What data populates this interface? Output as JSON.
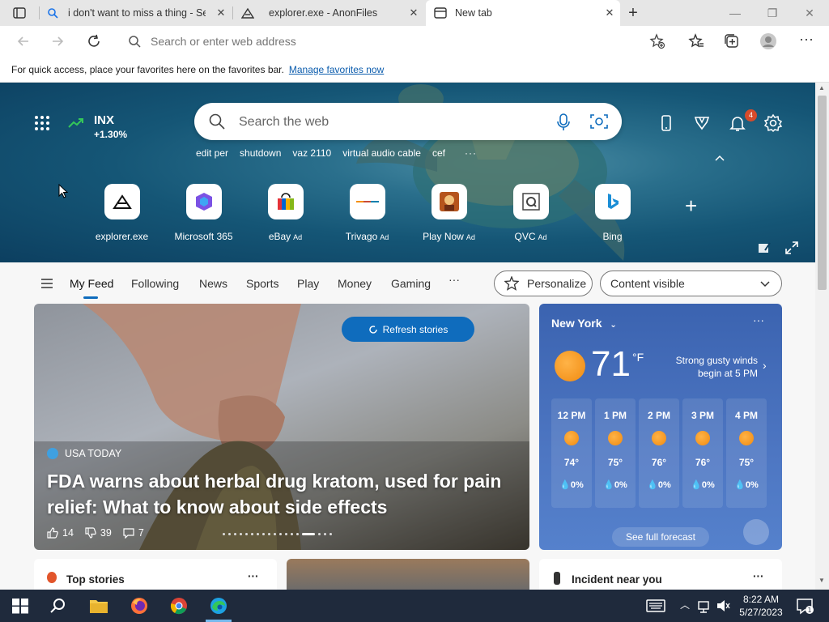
{
  "tabs": [
    {
      "label": "i don't want to miss a thing - Search",
      "icon": "search-icon"
    },
    {
      "label": "explorer.exe - AnonFiles",
      "icon": "anonfiles-icon"
    },
    {
      "label": "New tab",
      "icon": "newtab-icon"
    }
  ],
  "toolbar": {
    "address_placeholder": "Search or enter web address"
  },
  "favbar": {
    "message": "For quick access, place your favorites here on the favorites bar.",
    "link": "Manage favorites now"
  },
  "hero": {
    "ticker_symbol": "INX",
    "ticker_change": "+1.30%",
    "search_placeholder": "Search the web",
    "trending": [
      "edit per",
      "shutdown",
      "vaz 2110",
      "virtual audio cable",
      "cef"
    ],
    "notification_count": "4",
    "quick_links": [
      {
        "name": "explorer.exe",
        "ad": ""
      },
      {
        "name": "Microsoft 365",
        "ad": ""
      },
      {
        "name": "eBay",
        "ad": "Ad"
      },
      {
        "name": "Trivago",
        "ad": "Ad"
      },
      {
        "name": "Play Now",
        "ad": "Ad"
      },
      {
        "name": "QVC",
        "ad": "Ad"
      },
      {
        "name": "Bing",
        "ad": ""
      }
    ]
  },
  "feed_nav": {
    "items": [
      "My Feed",
      "Following",
      "News",
      "Sports",
      "Play",
      "Money",
      "Gaming"
    ],
    "personalize": "Personalize",
    "content_visible": "Content visible"
  },
  "story": {
    "refresh": "Refresh stories",
    "source": "USA TODAY",
    "headline": "FDA warns about herbal drug kratom, used for pain relief: What to know about side effects",
    "likes": "14",
    "dislikes": "39",
    "comments": "7"
  },
  "weather": {
    "city": "New York",
    "temp": "71",
    "unit": "°F",
    "alert": "Strong gusty winds begin at 5 PM",
    "hours": [
      {
        "time": "12 PM",
        "temp": "74°",
        "precip": "0%"
      },
      {
        "time": "1 PM",
        "temp": "75°",
        "precip": "0%"
      },
      {
        "time": "2 PM",
        "temp": "76°",
        "precip": "0%"
      },
      {
        "time": "3 PM",
        "temp": "76°",
        "precip": "0%"
      },
      {
        "time": "4 PM",
        "temp": "75°",
        "precip": "0%"
      }
    ],
    "forecast_button": "See full forecast"
  },
  "bottom_cards": {
    "top_stories": "Top stories",
    "incident": "Incident near you"
  },
  "taskbar": {
    "time": "8:22 AM",
    "date": "5/27/2023"
  }
}
